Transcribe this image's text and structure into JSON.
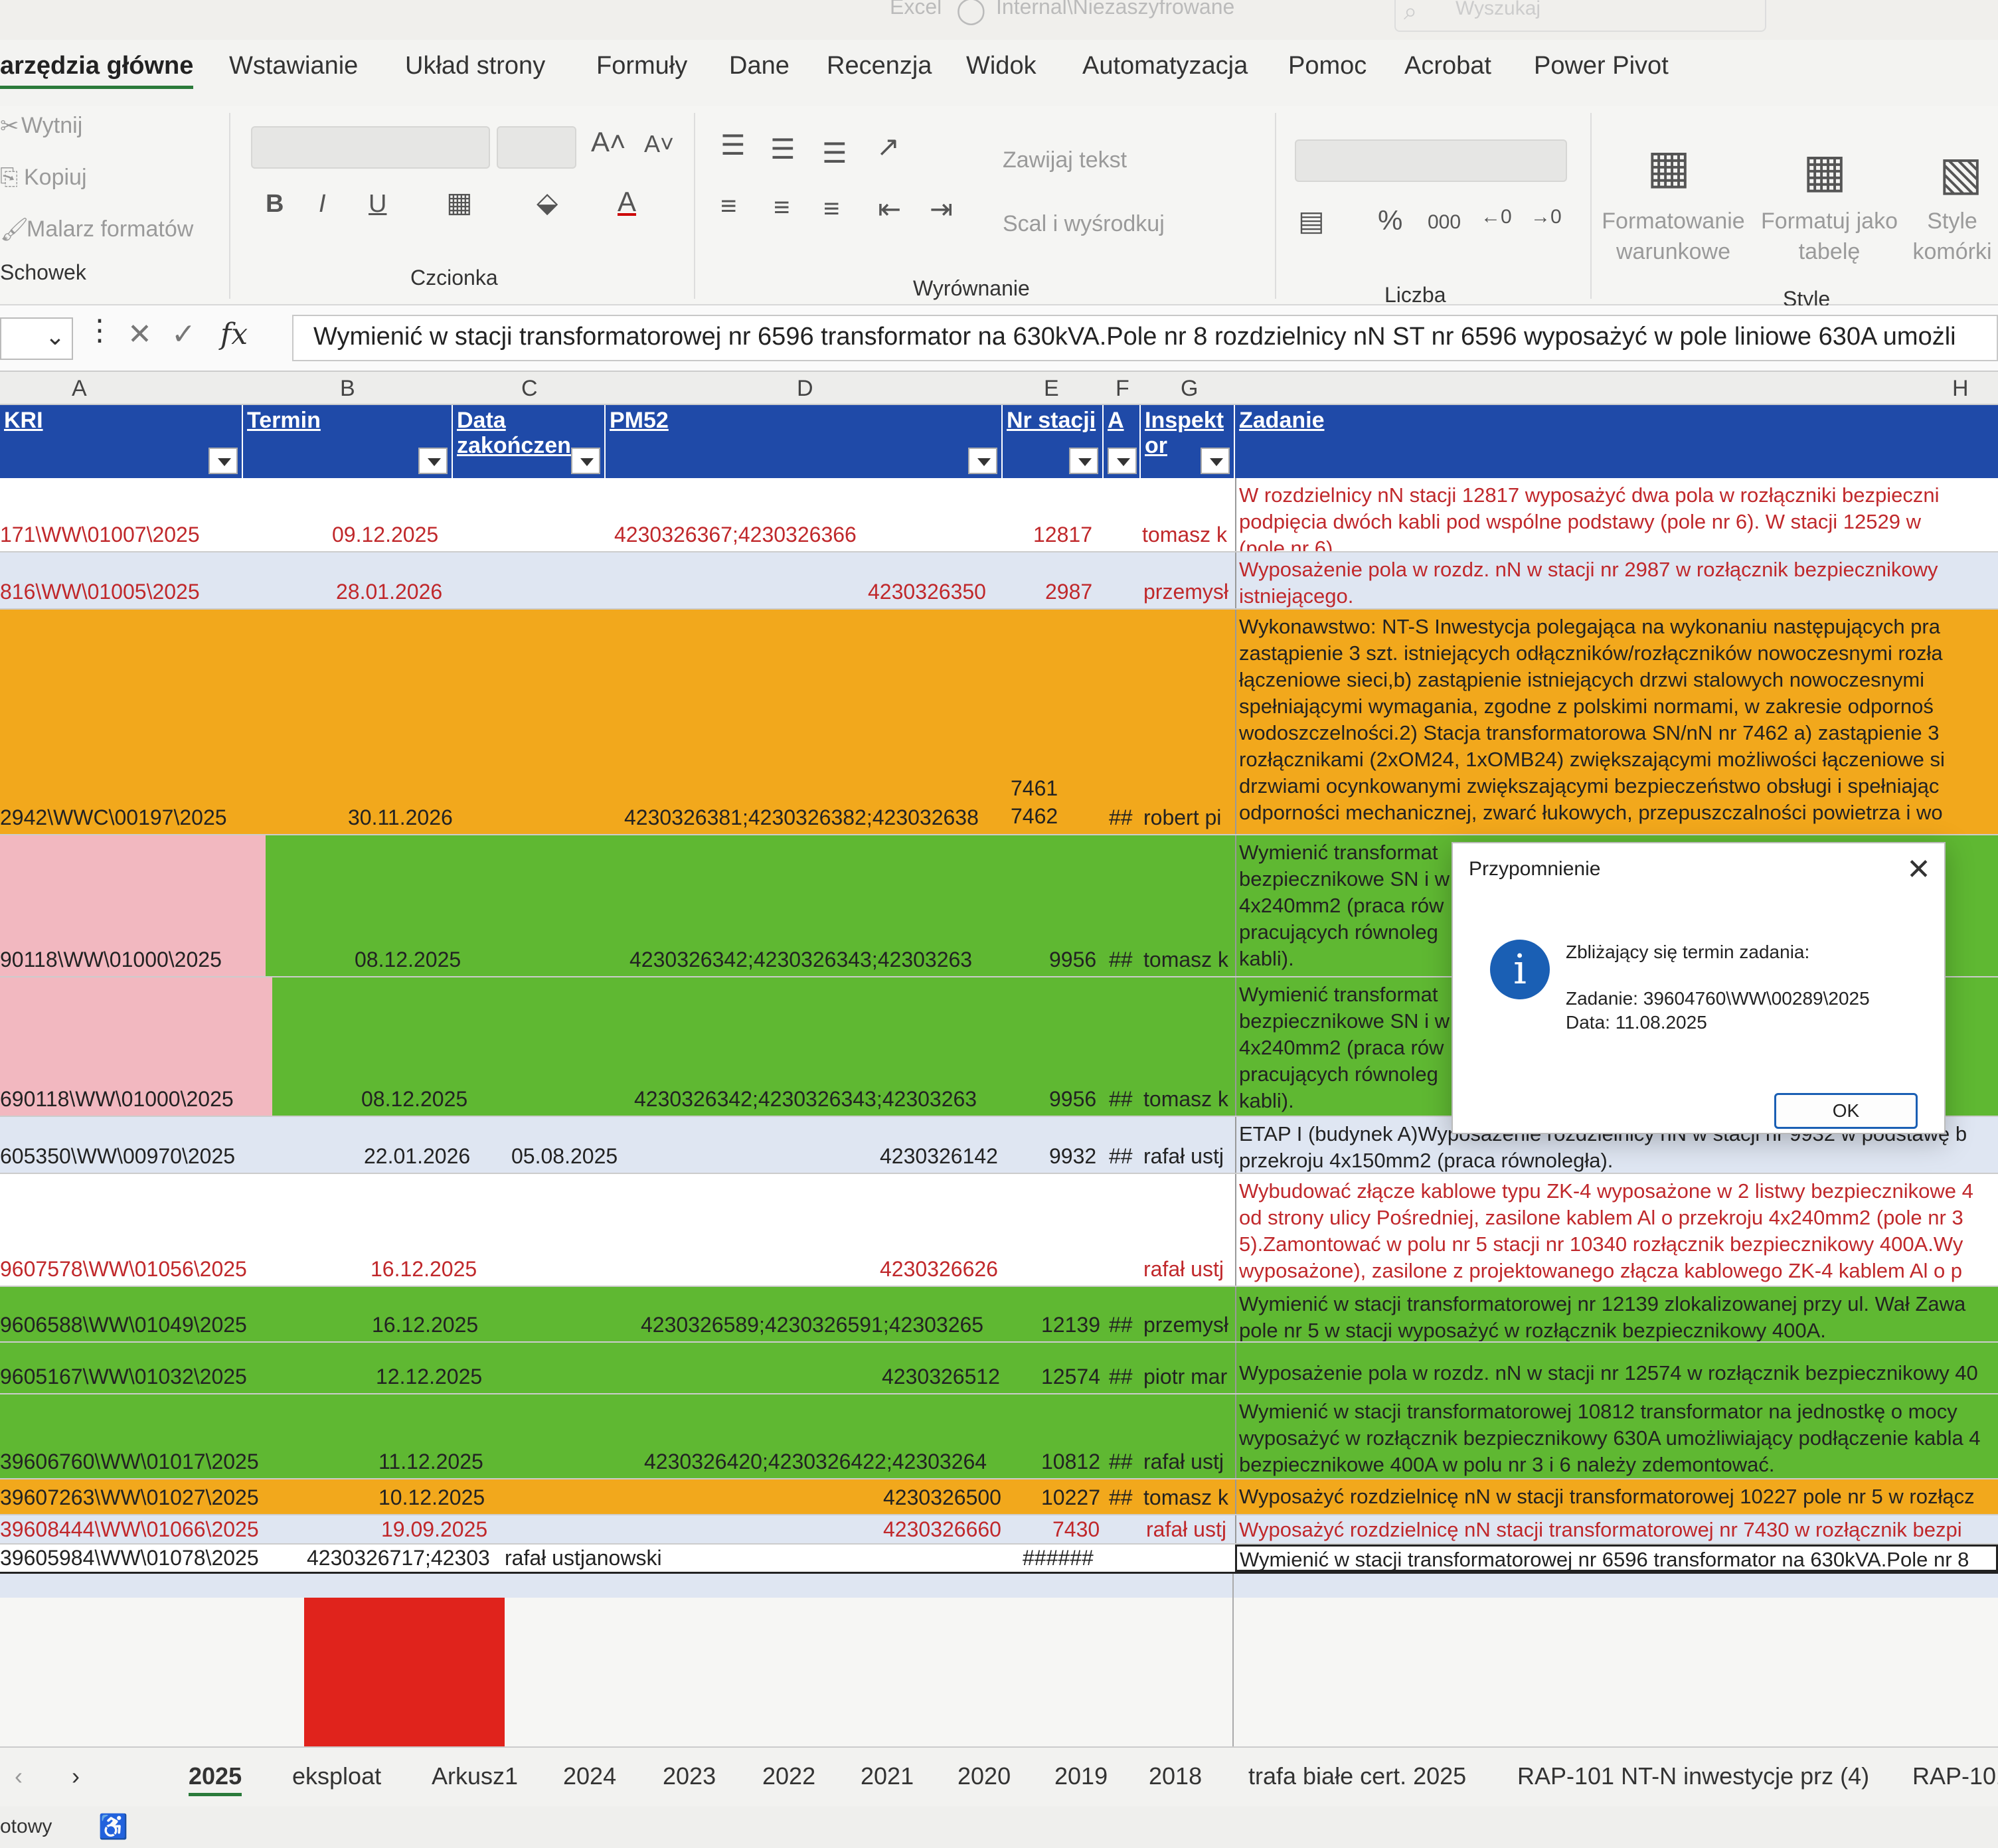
{
  "window": {
    "title_fragment": "Excel",
    "sensitivity": "Internal\\Niezaszyfrowane",
    "search_placeholder": "Wyszukaj"
  },
  "ribbon_tabs": [
    "arzędzia główne",
    "Wstawianie",
    "Układ strony",
    "Formuły",
    "Dane",
    "Recenzja",
    "Widok",
    "Automatyzacja",
    "Pomoc",
    "Acrobat",
    "Power Pivot"
  ],
  "clipboard": {
    "cut": "Wytnij",
    "copy": "Kopiuj",
    "painter": "Malarz formatów",
    "group": "Schowek"
  },
  "font_group": {
    "group": "Czcionka",
    "bold": "B",
    "italic": "I",
    "underline": "U"
  },
  "align_group": {
    "wrap": "Zawijaj tekst",
    "merge": "Scal i wyśrodkuj",
    "group": "Wyrównanie"
  },
  "number_group": {
    "percent": "%",
    "thousands": "000",
    "group": "Liczba"
  },
  "style_group": {
    "conditional": "Formatowanie warunkowe",
    "as_table": "Formatuj jako tabelę",
    "cell_styles": "Style komórki",
    "group": "Style"
  },
  "formula_bar": {
    "fx": "fx",
    "content": "Wymienić w stacji transformatorowej nr 6596 transformator na 630kVA.Pole nr 8 rozdzielnicy nN ST nr 6596 wyposażyć w pole liniowe 630A umożli"
  },
  "column_letters": [
    "A",
    "B",
    "C",
    "D",
    "E",
    "F",
    "G",
    "H"
  ],
  "headers": {
    "kri": "KRI",
    "termin": "Termin",
    "data_zak": "Data zakończen",
    "pm52": "PM52",
    "nr_stacji": "Nr stacji",
    "a": "A",
    "inspektor": "Inspekt or",
    "zadanie": "Zadanie"
  },
  "rows": [
    {
      "kri": "171\\WW\\01007\\2025",
      "termin": "09.12.2025",
      "data": "",
      "pm52": "4230326367;4230326366",
      "stacja": "12817",
      "a": "",
      "insp": "tomasz k",
      "task": [
        "W rozdzielnicy nN stacji 12817 wyposażyć dwa pola w rozłączniki bezpieczni",
        "podpięcia dwóch kabli pod wspólne podstawy (pole nr 6). W stacji 12529 w",
        "(pole nr 6)."
      ]
    },
    {
      "kri": "816\\WW\\01005\\2025",
      "termin": "28.01.2026",
      "data": "",
      "pm52": "4230326350",
      "stacja": "2987",
      "a": "",
      "insp": "przemysł",
      "task": [
        "Wyposażenie pola w rozdz. nN w stacji nr 2987 w rozłącznik bezpiecznikowy",
        "istniejącego."
      ]
    },
    {
      "kri": "2942\\WWC\\00197\\2025",
      "termin": "30.11.2026",
      "data": "",
      "pm52": "4230326381;4230326382;423032638",
      "stacja": "7461 7462",
      "a": "##",
      "insp": "robert pi",
      "task": [
        "Wykonawstwo: NT-S Inwestycja polegająca na wykonaniu następujących pra",
        "zastąpienie 3 szt. istniejących odłączników/rozłączników nowoczesnymi rozła",
        "łączeniowe sieci,b) zastąpienie istniejących drzwi stalowych nowoczesnymi",
        "spełniającymi wymagania, zgodne z polskimi normami, w zakresie odpornoś",
        "wodoszczelności.2) Stacja transformatorowa SN/nN nr 7462 a) zastąpienie 3",
        "rozłącznikami (2xOM24, 1xOMB24) zwiększającymi możliwości łączeniowe si",
        "drzwiami ocynkowanymi zwiększającymi bezpieczeństwo obsługi i spełniając",
        "odporności mechanicznej, zwarć łukowych, przepuszczalności powietrza i wo"
      ]
    },
    {
      "kri": "90118\\WW\\01000\\2025",
      "termin": "08.12.2025",
      "data": "",
      "pm52": "4230326342;4230326343;42303263",
      "stacja": "9956",
      "a": "##",
      "insp": "tomasz k",
      "task": [
        "Wymienić transformat",
        "bezpiecznikowe SN i w",
        "4x240mm2 (praca rów",
        "pracujących równoleg",
        "kabli)."
      ]
    },
    {
      "kri": "690118\\WW\\01000\\2025",
      "termin": "08.12.2025",
      "data": "",
      "pm52": "4230326342;4230326343;42303263",
      "stacja": "9956",
      "a": "##",
      "insp": "tomasz k",
      "task": [
        "Wymienić transformat",
        "bezpiecznikowe SN i w",
        "4x240mm2 (praca rów",
        "pracujących równoleg",
        "kabli)."
      ]
    },
    {
      "kri": "605350\\WW\\00970\\2025",
      "termin": "22.01.2026",
      "data": "05.08.2025",
      "pm52": "4230326142",
      "stacja": "9932",
      "a": "##",
      "insp": "rafał ustj",
      "task": [
        "ETAP I (budynek A)Wyposażenie rozdzielnicy nN w stacji nr 9932 w podstawę b",
        "przekroju 4x150mm2 (praca równoległa)."
      ]
    },
    {
      "kri": "9607578\\WW\\01056\\2025",
      "termin": "16.12.2025",
      "data": "",
      "pm52": "4230326626",
      "stacja": "",
      "a": "",
      "insp": "rafał ustj",
      "task": [
        "Wybudować złącze kablowe typu ZK-4 wyposażone w 2 listwy bezpiecznikowe 4",
        "od strony ulicy Pośredniej, zasilone kablem Al o przekroju 4x240mm2 (pole nr 3",
        "5).Zamontować w polu nr 5 stacji nr 10340  rozłącznik bezpiecznikowy 400A.Wy",
        "wyposażone), zasilone z projektowanego złącza kablowego ZK-4 kablem Al o p"
      ]
    },
    {
      "kri": "9606588\\WW\\01049\\2025",
      "termin": "16.12.2025",
      "data": "",
      "pm52": "4230326589;4230326591;42303265",
      "stacja": "12139",
      "a": "##",
      "insp": "przemysł",
      "task": [
        "Wymienić w stacji transformatorowej nr 12139 zlokalizowanej przy ul. Wał Zawa",
        "pole nr 5 w stacji wyposażyć w rozłącznik bezpiecznikowy 400A."
      ]
    },
    {
      "kri": "9605167\\WW\\01032\\2025",
      "termin": "12.12.2025",
      "data": "",
      "pm52": "4230326512",
      "stacja": "12574",
      "a": "##",
      "insp": "piotr mar",
      "task": [
        "Wyposażenie pola w rozdz. nN w stacji nr 12574 w rozłącznik bezpiecznikowy 40"
      ]
    },
    {
      "kri": "39606760\\WW\\01017\\2025",
      "termin": "11.12.2025",
      "data": "",
      "pm52": "4230326420;4230326422;42303264",
      "stacja": "10812",
      "a": "##",
      "insp": "rafał ustj",
      "task": [
        "Wymienić w stacji transformatorowej 10812 transformator na jednostkę o mocy",
        "wyposażyć w rozłącznik bezpiecznikowy 630A umożliwiający podłączenie kabla 4",
        "bezpiecznikowe 400A w polu nr 3 i 6 należy zdemontować."
      ]
    },
    {
      "kri": "39607263\\WW\\01027\\2025",
      "termin": "10.12.2025",
      "data": "",
      "pm52": "4230326500",
      "stacja": "10227",
      "a": "##",
      "insp": "tomasz k",
      "task": [
        "Wyposażyć rozdzielnicę nN w stacji transformatorowej 10227 pole nr 5 w rozłącz"
      ]
    },
    {
      "kri": "39608444\\WW\\01066\\2025",
      "termin": "19.09.2025",
      "data": "",
      "pm52": "4230326660",
      "stacja": "7430",
      "a": "",
      "insp": "rafał ustj",
      "task": [
        "Wyposażyć rozdzielnicę nN stacji transformatorowej nr 7430 w rozłącznik bezpi"
      ]
    },
    {
      "kri": "39605984\\WW\\01078\\2025",
      "termin": "4230326717;42303",
      "data": "rafał ustjanowski",
      "pm52": "",
      "stacja": "######",
      "a": "",
      "insp": "",
      "task": [
        "Wymienić w stacji transformatorowej nr 6596 transformator na 630kVA.Pole nr 8"
      ]
    }
  ],
  "dialog": {
    "title": "Przypomnienie",
    "heading": "Zbliżający się termin zadania:",
    "task_line": "Zadanie: 39604760\\WW\\00289\\2025",
    "date_line": "Data: 11.08.2025",
    "ok": "OK"
  },
  "sheet_tabs": [
    "2025",
    "eksploat",
    "Arkusz1",
    "2024",
    "2023",
    "2022",
    "2021",
    "2020",
    "2019",
    "2018",
    "trafa białe cert. 2025",
    "RAP-101 NT-N inwestycje prz (4)",
    "RAP-101"
  ],
  "status_text": "otowy",
  "colors": {
    "header_blue": "#1f4aa8",
    "orange": "#f2a81c",
    "green": "#5fb832",
    "pink": "#f2b8c0",
    "red": "#e0231c",
    "light_blue": "#dfe6f2"
  }
}
